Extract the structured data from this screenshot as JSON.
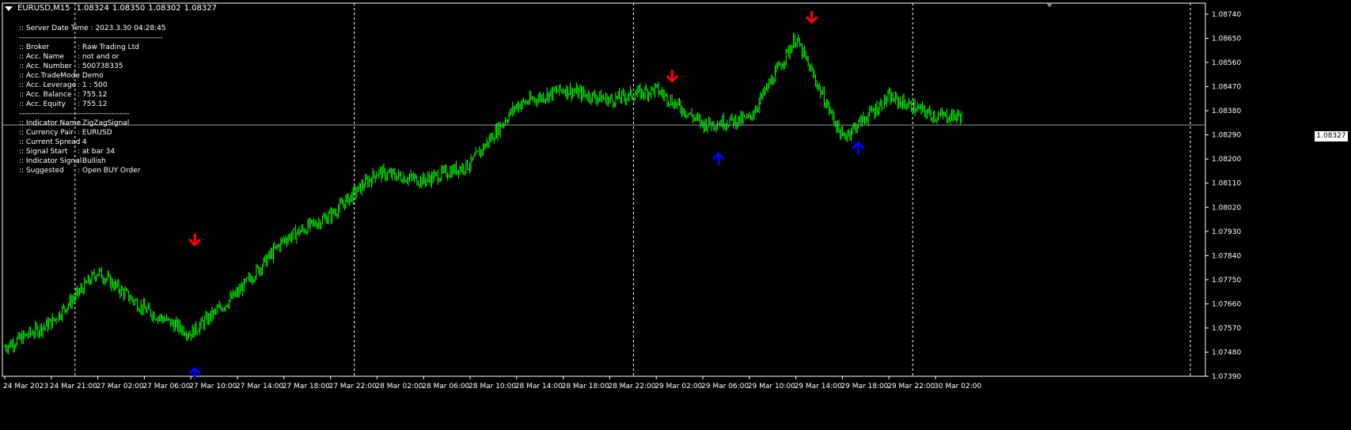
{
  "header": {
    "symbol": "EURUSD,M15",
    "open": "1.08324",
    "high": "1.08350",
    "low": "1.08302",
    "close": "1.08327"
  },
  "info_panel": {
    "server_time": ":: Server Date Time : 2023.3.30   04:28:45",
    "separator": "--------------------------------------------------------",
    "separator2": "-------------------------------------------",
    "account": [
      {
        "key": ":: Broker",
        "value": ": Raw Trading Ltd"
      },
      {
        "key": ":: Acc. Name",
        "value": ": not and or"
      },
      {
        "key": ":: Acc. Number",
        "value": ": 500738335"
      },
      {
        "key": ":: Acc.TradeMode",
        "value": ": Demo"
      },
      {
        "key": ":: Acc. Leverage",
        "value": ": 1 : 500"
      },
      {
        "key": ":: Acc. Balance",
        "value": ": 755.12"
      },
      {
        "key": ":: Acc. Equity",
        "value": ": 755.12"
      }
    ],
    "indicator": [
      {
        "key": ":: Indicator Name",
        "value": ": ZigZagSignal"
      },
      {
        "key": ":: Currency Pair",
        "value": ": EURUSD"
      },
      {
        "key": ":: Current Spread",
        "value": ": 4"
      },
      {
        "key": ":: Signal Start",
        "value": ": at bar 34"
      },
      {
        "key": ":: Indicator Signal",
        "value": ": Bullish"
      },
      {
        "key": ":: Suggested",
        "value": ": Open BUY Order"
      }
    ]
  },
  "current_price": "1.08327",
  "colors": {
    "background": "#000000",
    "candle": "#00ff00",
    "grid": "#ffffff",
    "sell_arrow": "#ff0000",
    "buy_arrow": "#0000ff",
    "price_line": "#8c9aa8"
  },
  "chart_data": {
    "type": "candlestick",
    "y_axis_ticks": [
      "1.08740",
      "1.08650",
      "1.08560",
      "1.08470",
      "1.08380",
      "1.08290",
      "1.08200",
      "1.08110",
      "1.08020",
      "1.07930",
      "1.07840",
      "1.07750",
      "1.07660",
      "1.07570",
      "1.07480",
      "1.07390"
    ],
    "x_axis_ticks": [
      "24 Mar 2023",
      "24 Mar 21:00",
      "27 Mar 02:00",
      "27 Mar 06:00",
      "27 Mar 10:00",
      "27 Mar 14:00",
      "27 Mar 18:00",
      "27 Mar 22:00",
      "28 Mar 02:00",
      "28 Mar 06:00",
      "28 Mar 10:00",
      "28 Mar 14:00",
      "28 Mar 18:00",
      "28 Mar 22:00",
      "29 Mar 02:00",
      "29 Mar 06:00",
      "29 Mar 10:00",
      "29 Mar 14:00",
      "29 Mar 18:00",
      "29 Mar 22:00",
      "30 Mar 02:00"
    ],
    "ylim": [
      1.0739,
      1.0874
    ],
    "day_separators": [
      "24 Mar 21:00",
      "27 Mar 22:00",
      "28 Mar 22:00",
      "29 Mar 22:00"
    ],
    "close_path": [
      [
        "24 Mar 2023",
        1.075
      ],
      [
        "24 Mar 21:00",
        1.0759
      ],
      [
        "27 Mar 02:00",
        1.0778
      ],
      [
        "27 Mar 06:00",
        1.0764
      ],
      [
        "27 Mar 10:00",
        1.0755
      ],
      [
        "27 Mar 14:00",
        1.077
      ],
      [
        "27 Mar 18:00",
        1.079
      ],
      [
        "27 Mar 22:00",
        1.0799
      ],
      [
        "28 Mar 02:00",
        1.0815
      ],
      [
        "28 Mar 06:00",
        1.0812
      ],
      [
        "28 Mar 10:00",
        1.0818
      ],
      [
        "28 Mar 14:00",
        1.084
      ],
      [
        "28 Mar 18:00",
        1.0846
      ],
      [
        "28 Mar 22:00",
        1.0842
      ],
      [
        "29 Mar 02:00",
        1.0846
      ],
      [
        "29 Mar 06:00",
        1.0833
      ],
      [
        "29 Mar 10:00",
        1.0835
      ],
      [
        "29 Mar 14:00",
        1.0865
      ],
      [
        "29 Mar 18:00",
        1.0828
      ],
      [
        "29 Mar 22:00",
        1.0843
      ],
      [
        "30 Mar 02:00",
        1.0836
      ]
    ],
    "signals": [
      {
        "type": "sell",
        "at": "27 Mar 10:00",
        "price": 1.0788
      },
      {
        "type": "buy",
        "at": "27 Mar 10:00",
        "price": 1.0742
      },
      {
        "type": "sell",
        "at": "29 Mar 02:00",
        "price": 1.0849
      },
      {
        "type": "buy",
        "at": "29 Mar 06:00",
        "price": 1.0822
      },
      {
        "type": "sell",
        "at": "29 Mar 14:00",
        "price": 1.0871
      },
      {
        "type": "buy",
        "at": "29 Mar 18:00",
        "price": 1.0826
      }
    ]
  }
}
